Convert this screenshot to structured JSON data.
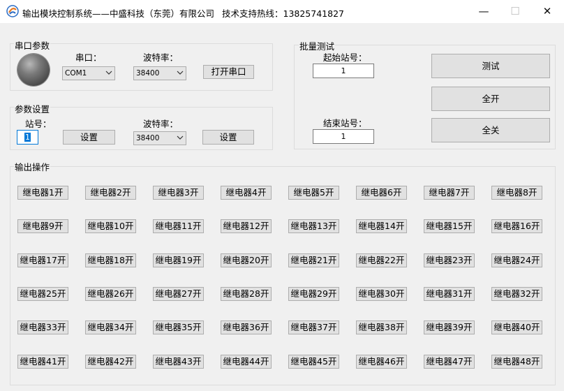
{
  "window": {
    "title": "输出模块控制系统——中盛科技（东莞）有限公司",
    "hotline": "技术支持热线：13825741827",
    "buttons": {
      "minimize": "—",
      "maximize": "☐",
      "close": "✕"
    }
  },
  "serial": {
    "group_title": "串口参数",
    "port_label": "串口：",
    "port_value": "COM1",
    "baud_label": "波特率：",
    "baud_value": "38400",
    "open_button": "打开串口"
  },
  "params": {
    "group_title": "参数设置",
    "station_label": "站号：",
    "station_value": "1",
    "set_button_1": "设置",
    "baud_label": "波特率：",
    "baud_value": "38400",
    "set_button_2": "设置"
  },
  "batch": {
    "group_title": "批量测试",
    "start_label": "起始站号：",
    "start_value": "1",
    "end_label": "结束站号：",
    "end_value": "1",
    "test_button": "测试",
    "all_on_button": "全开",
    "all_off_button": "全关"
  },
  "output": {
    "group_title": "输出操作",
    "relays": [
      "继电器1开",
      "继电器2开",
      "继电器3开",
      "继电器4开",
      "继电器5开",
      "继电器6开",
      "继电器7开",
      "继电器8开",
      "继电器9开",
      "继电器10开",
      "继电器11开",
      "继电器12开",
      "继电器13开",
      "继电器14开",
      "继电器15开",
      "继电器16开",
      "继电器17开",
      "继电器18开",
      "继电器19开",
      "继电器20开",
      "继电器21开",
      "继电器22开",
      "继电器23开",
      "继电器24开",
      "继电器25开",
      "继电器26开",
      "继电器27开",
      "继电器28开",
      "继电器29开",
      "继电器30开",
      "继电器31开",
      "继电器32开",
      "继电器33开",
      "继电器34开",
      "继电器35开",
      "继电器36开",
      "继电器37开",
      "继电器38开",
      "继电器39开",
      "继电器40开",
      "继电器41开",
      "继电器42开",
      "继电器43开",
      "继电器44开",
      "继电器45开",
      "继电器46开",
      "继电器47开",
      "继电器48开"
    ]
  },
  "icons": {
    "app": "app-logo-icon",
    "dropdown": "chevron-down-icon",
    "led": "status-led-icon"
  },
  "colors": {
    "window_bg": "#f0f0f0",
    "titlebar_bg": "#ffffff",
    "button_bg": "#e1e1e1",
    "focus_accent": "#0078d7"
  }
}
